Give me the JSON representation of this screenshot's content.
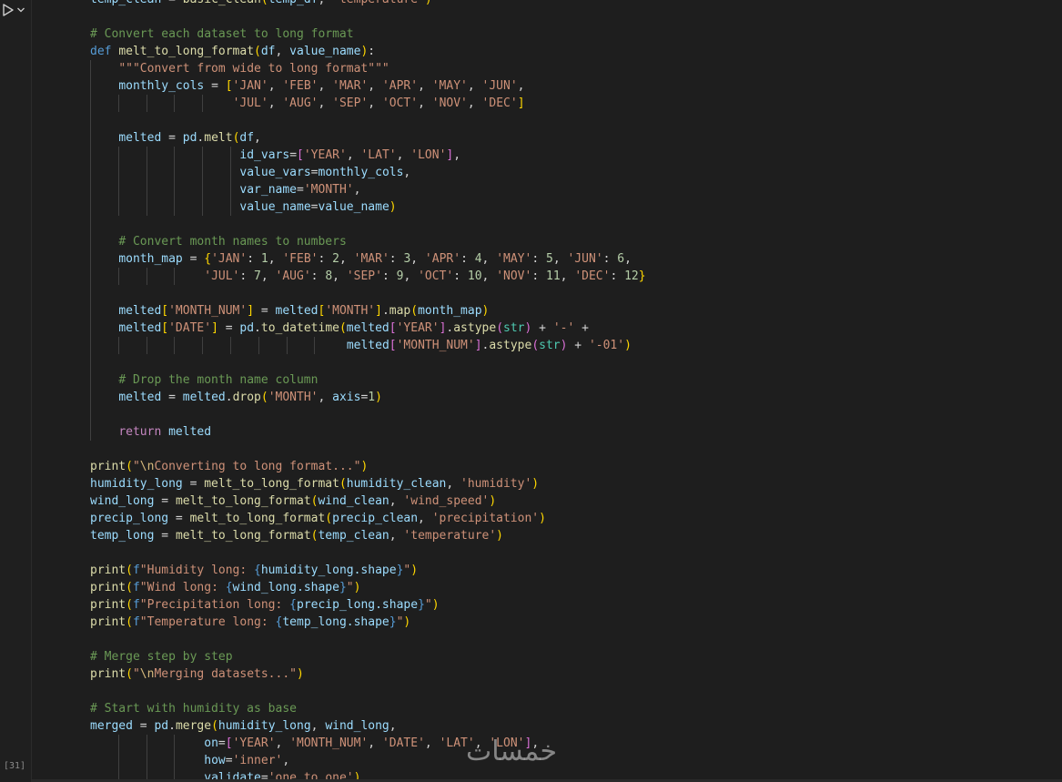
{
  "gutter": {
    "run_icon": "play-icon",
    "chevron_icon": "chevron-down-icon",
    "execution_count": "[31]"
  },
  "watermark": "خمسات",
  "code_lines": [
    "temp_clean = basic_clean(temp_df, 'temperature')",
    "",
    "# Convert each dataset to long format",
    "def melt_to_long_format(df, value_name):",
    "    \"\"\"Convert from wide to long format\"\"\"",
    "    monthly_cols = ['JAN', 'FEB', 'MAR', 'APR', 'MAY', 'JUN',",
    "                    'JUL', 'AUG', 'SEP', 'OCT', 'NOV', 'DEC']",
    "",
    "    melted = pd.melt(df,",
    "                     id_vars=['YEAR', 'LAT', 'LON'],",
    "                     value_vars=monthly_cols,",
    "                     var_name='MONTH',",
    "                     value_name=value_name)",
    "",
    "    # Convert month names to numbers",
    "    month_map = {'JAN': 1, 'FEB': 2, 'MAR': 3, 'APR': 4, 'MAY': 5, 'JUN': 6,",
    "                'JUL': 7, 'AUG': 8, 'SEP': 9, 'OCT': 10, 'NOV': 11, 'DEC': 12}",
    "",
    "    melted['MONTH_NUM'] = melted['MONTH'].map(month_map)",
    "    melted['DATE'] = pd.to_datetime(melted['YEAR'].astype(str) + '-' +",
    "                                    melted['MONTH_NUM'].astype(str) + '-01')",
    "",
    "    # Drop the month name column",
    "    melted = melted.drop('MONTH', axis=1)",
    "",
    "    return melted",
    "",
    "print(\"\\nConverting to long format...\")",
    "humidity_long = melt_to_long_format(humidity_clean, 'humidity')",
    "wind_long = melt_to_long_format(wind_clean, 'wind_speed')",
    "precip_long = melt_to_long_format(precip_clean, 'precipitation')",
    "temp_long = melt_to_long_format(temp_clean, 'temperature')",
    "",
    "print(f\"Humidity long: {humidity_long.shape}\")",
    "print(f\"Wind long: {wind_long.shape}\")",
    "print(f\"Precipitation long: {precip_long.shape}\")",
    "print(f\"Temperature long: {temp_long.shape}\")",
    "",
    "# Merge step by step",
    "print(\"\\nMerging datasets...\")",
    "",
    "# Start with humidity as base",
    "merged = pd.merge(humidity_long, wind_long,",
    "                on=['YEAR', 'MONTH_NUM', 'DATE', 'LAT', 'LON'],",
    "                how='inner',",
    "                validate='one_to_one')"
  ]
}
